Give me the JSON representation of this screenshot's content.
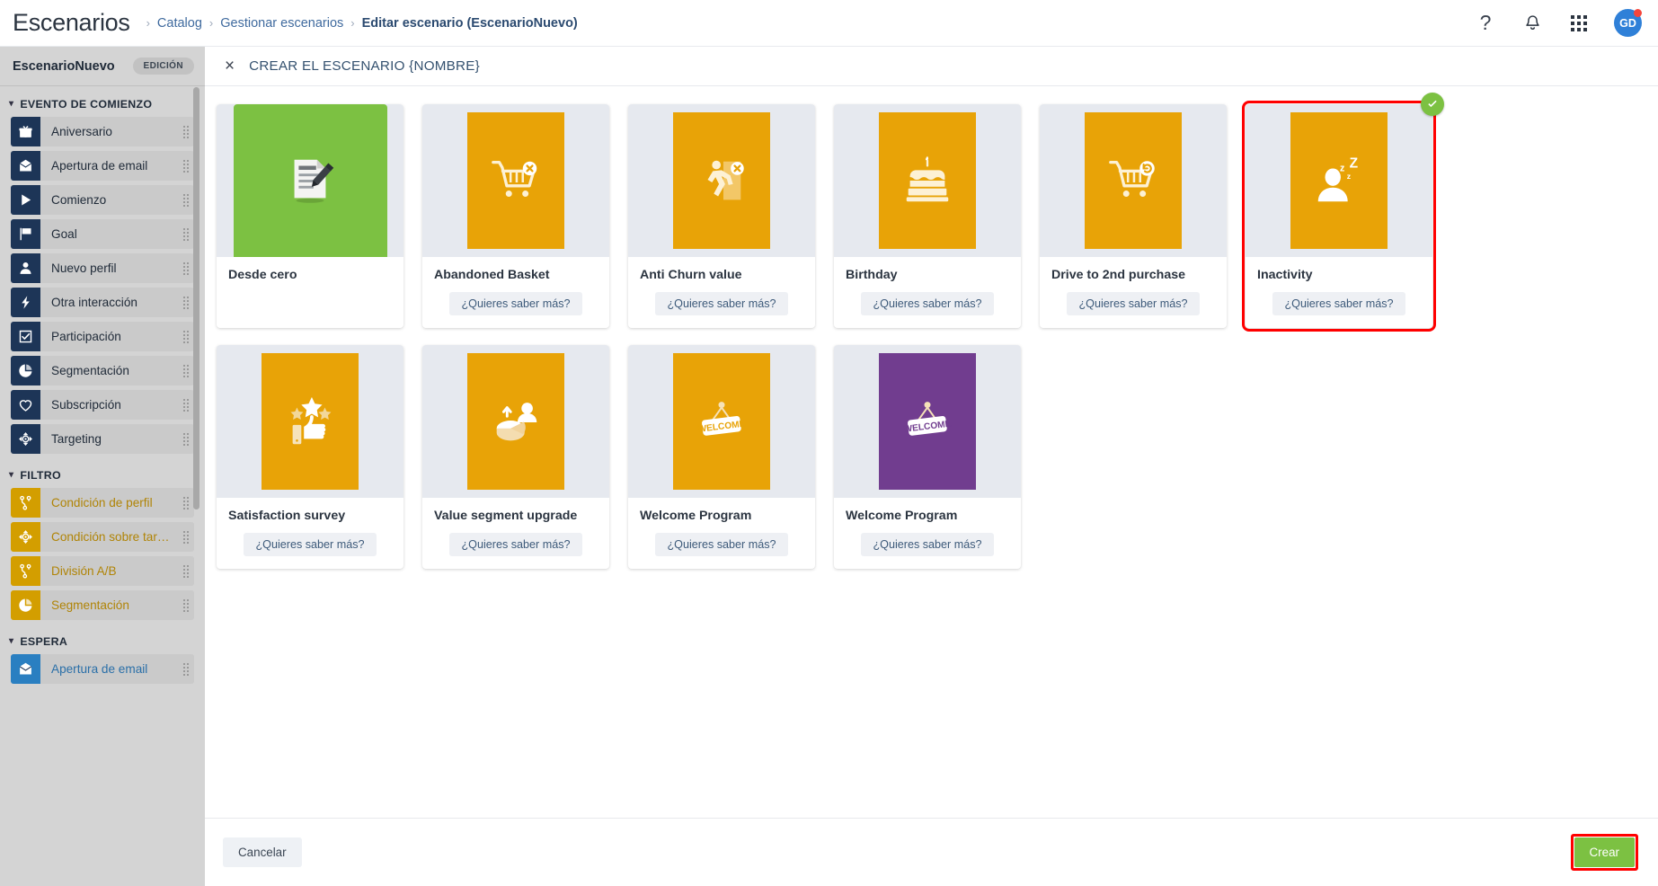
{
  "topbar": {
    "app_title": "Escenarios",
    "breadcrumb": [
      "Catalog",
      "Gestionar escenarios",
      "Editar escenario (EscenarioNuevo)"
    ],
    "help_icon": "question-mark-icon",
    "bell_icon": "bell-icon",
    "apps_icon": "grid-apps-icon",
    "avatar_initials": "GD"
  },
  "sidebar": {
    "scenario_name": "EscenarioNuevo",
    "status_badge": "EDICIÓN",
    "sections": [
      {
        "label": "EVENTO DE COMIENZO",
        "color": "navy",
        "items": [
          {
            "label": "Aniversario",
            "icon": "gift-icon"
          },
          {
            "label": "Apertura de email",
            "icon": "envelope-open-icon"
          },
          {
            "label": "Comienzo",
            "icon": "play-icon"
          },
          {
            "label": "Goal",
            "icon": "flag-icon"
          },
          {
            "label": "Nuevo perfil",
            "icon": "user-icon"
          },
          {
            "label": "Otra interacción",
            "icon": "lightning-icon"
          },
          {
            "label": "Participación",
            "icon": "checkbox-icon"
          },
          {
            "label": "Segmentación",
            "icon": "pie-chart-icon"
          },
          {
            "label": "Subscripción",
            "icon": "heart-icon"
          },
          {
            "label": "Targeting",
            "icon": "target-icon"
          }
        ]
      },
      {
        "label": "FILTRO",
        "color": "gold",
        "items": [
          {
            "label": "Condición de perfil",
            "icon": "branch-icon"
          },
          {
            "label": "Condición sobre targeti...",
            "icon": "target-icon"
          },
          {
            "label": "División A/B",
            "icon": "branch-icon"
          },
          {
            "label": "Segmentación",
            "icon": "pie-chart-icon"
          }
        ]
      },
      {
        "label": "ESPERA",
        "color": "blue",
        "items": [
          {
            "label": "Apertura de email",
            "icon": "envelope-open-icon"
          }
        ]
      }
    ]
  },
  "modal": {
    "close_label": "×",
    "title": "CREAR EL ESCENARIO {NOMBRE}",
    "know_more_label": "¿Quieres saber más?",
    "cards": [
      {
        "title": "Desde cero",
        "color": "green",
        "icon": "document-pencil-icon",
        "wide": true,
        "has_button": false,
        "selected": false
      },
      {
        "title": "Abandoned Basket",
        "color": "gold",
        "icon": "cart-remove-icon",
        "wide": false,
        "has_button": true,
        "selected": false
      },
      {
        "title": "Anti Churn value",
        "color": "gold",
        "icon": "running-exit-icon",
        "wide": false,
        "has_button": true,
        "selected": false
      },
      {
        "title": "Birthday",
        "color": "gold",
        "icon": "cake-icon",
        "wide": false,
        "has_button": true,
        "selected": false
      },
      {
        "title": "Drive to 2nd purchase",
        "color": "gold",
        "icon": "cart-repeat-icon",
        "wide": false,
        "has_button": true,
        "selected": false
      },
      {
        "title": "Inactivity",
        "color": "gold",
        "icon": "sleeping-user-icon",
        "wide": false,
        "has_button": true,
        "selected": true
      },
      {
        "title": "Satisfaction survey",
        "color": "gold",
        "icon": "thumbs-up-stars-icon",
        "wide": false,
        "has_button": true,
        "selected": false
      },
      {
        "title": "Value segment upgrade",
        "color": "gold",
        "icon": "pie-upgrade-icon",
        "wide": false,
        "has_button": true,
        "selected": false
      },
      {
        "title": "Welcome Program",
        "color": "gold",
        "icon": "welcome-sign-icon",
        "wide": false,
        "has_button": true,
        "selected": false
      },
      {
        "title": "Welcome Program",
        "color": "purple",
        "icon": "welcome-sign-icon",
        "wide": false,
        "has_button": true,
        "selected": false
      }
    ]
  },
  "footer": {
    "cancel_label": "Cancelar",
    "create_label": "Crear"
  },
  "colors": {
    "green": "#7cc142",
    "gold": "#e8a307",
    "purple": "#713d8f",
    "navy": "#1d3557",
    "highlight_red": "#ff0000",
    "accent_blue": "#2f80d8"
  }
}
